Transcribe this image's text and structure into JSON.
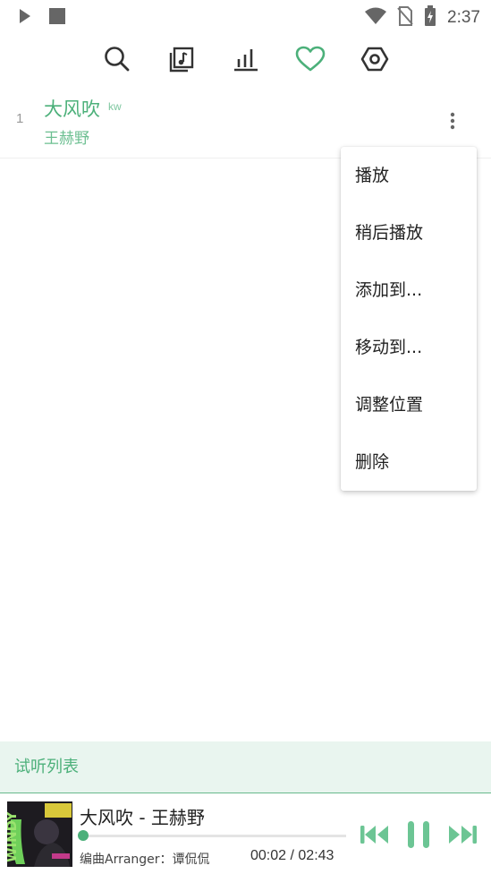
{
  "status_bar": {
    "time": "2:37"
  },
  "colors": {
    "accent": "#4cb07a",
    "accent_light": "#e9f5ef",
    "icon_gray": "#333333"
  },
  "toolbar": {
    "icons": [
      "search-icon",
      "music-library-icon",
      "chart-bars-icon",
      "heart-icon",
      "settings-hexagon-icon"
    ],
    "active": "heart-icon"
  },
  "list": {
    "items": [
      {
        "index": "1",
        "title": "大风吹",
        "source": "kw",
        "artist": "王赫野"
      }
    ]
  },
  "context_menu": {
    "items": [
      "播放",
      "稍后播放",
      "添加到...",
      "移动到...",
      "调整位置",
      "删除"
    ]
  },
  "playlist_label": "试听列表",
  "player": {
    "title": "大风吹 - 王赫野",
    "lyric": "编曲Arranger：谭侃侃",
    "current_time": "00:02",
    "separator": " / ",
    "total_time": "02:43",
    "progress": 0.012,
    "cover_text": "WINDY"
  }
}
